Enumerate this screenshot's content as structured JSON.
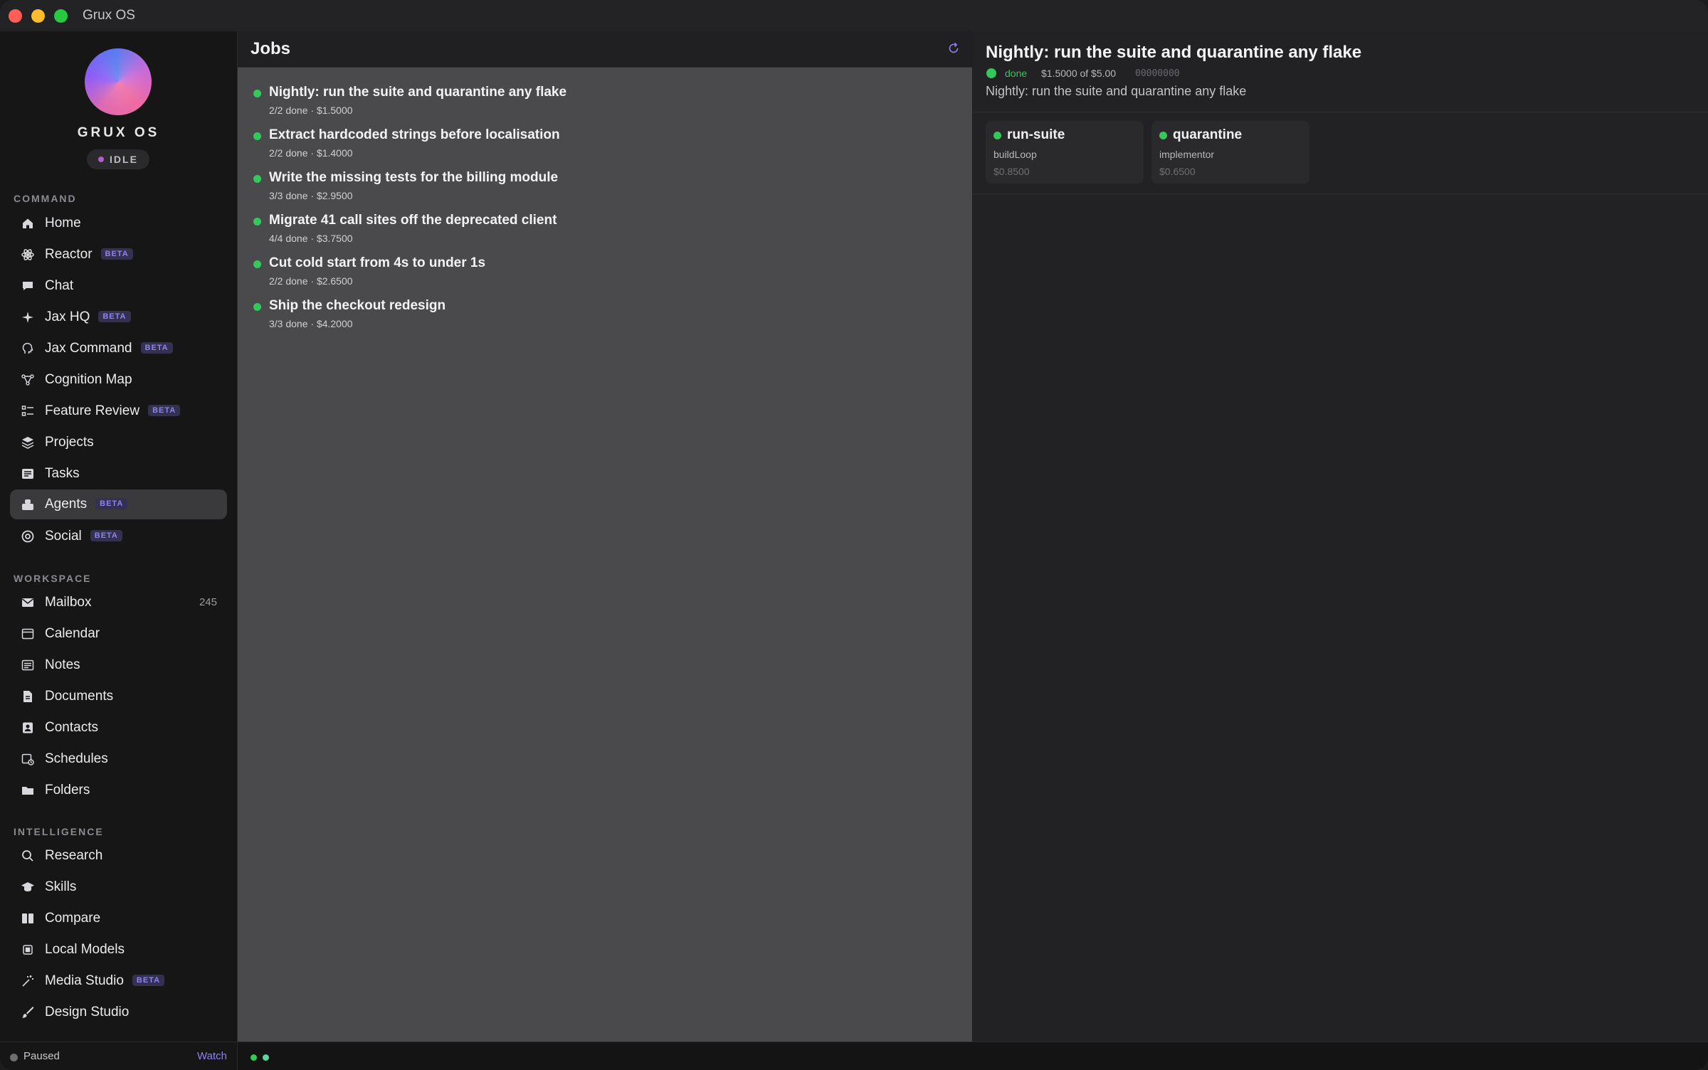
{
  "window": {
    "title": "Grux OS"
  },
  "sidebar": {
    "brand": "GRUX OS",
    "status": "IDLE",
    "sections": {
      "command": "COMMAND",
      "workspace": "WORKSPACE",
      "intelligence": "INTELLIGENCE"
    },
    "items": [
      {
        "label": "Home",
        "icon": "home-icon"
      },
      {
        "label": "Reactor",
        "icon": "atom-icon",
        "badge": "BETA"
      },
      {
        "label": "Chat",
        "icon": "chat-bubble-icon"
      },
      {
        "label": "Jax HQ",
        "icon": "sparkle-icon",
        "badge": "BETA"
      },
      {
        "label": "Jax Command",
        "icon": "head-icon",
        "badge": "BETA"
      },
      {
        "label": "Cognition Map",
        "icon": "graph-icon"
      },
      {
        "label": "Feature Review",
        "icon": "checklist-icon",
        "badge": "BETA"
      },
      {
        "label": "Projects",
        "icon": "layers-icon"
      },
      {
        "label": "Tasks",
        "icon": "tasks-icon"
      },
      {
        "label": "Agents",
        "icon": "agents-icon",
        "badge": "BETA"
      },
      {
        "label": "Social",
        "icon": "at-icon",
        "badge": "BETA"
      },
      {
        "label": "Mailbox",
        "icon": "envelope-icon",
        "count": "245"
      },
      {
        "label": "Calendar",
        "icon": "calendar-icon"
      },
      {
        "label": "Notes",
        "icon": "notes-icon"
      },
      {
        "label": "Documents",
        "icon": "document-icon"
      },
      {
        "label": "Contacts",
        "icon": "contacts-icon"
      },
      {
        "label": "Schedules",
        "icon": "schedule-icon"
      },
      {
        "label": "Folders",
        "icon": "folder-icon"
      },
      {
        "label": "Research",
        "icon": "search-icon"
      },
      {
        "label": "Skills",
        "icon": "graduation-cap-icon"
      },
      {
        "label": "Compare",
        "icon": "columns-icon"
      },
      {
        "label": "Local Models",
        "icon": "chip-icon"
      },
      {
        "label": "Media Studio",
        "icon": "magic-wand-icon",
        "badge": "BETA"
      },
      {
        "label": "Design Studio",
        "icon": "brush-icon"
      }
    ],
    "footer": {
      "status": "Paused",
      "action": "Watch"
    }
  },
  "jobs": {
    "title": "Jobs",
    "items": [
      {
        "title": "Nightly: run the suite and quarantine any flake",
        "meta": "2/2 done  · $1.5000"
      },
      {
        "title": "Extract hardcoded strings before localisation",
        "meta": "2/2 done  · $1.4000"
      },
      {
        "title": "Write the missing tests for the billing module",
        "meta": "3/3 done  · $2.9500"
      },
      {
        "title": "Migrate 41 call sites off the deprecated client",
        "meta": "4/4 done  · $3.7500"
      },
      {
        "title": "Cut cold start from 4s to under 1s",
        "meta": "2/2 done  · $2.6500"
      },
      {
        "title": "Ship the checkout redesign",
        "meta": "3/3 done  · $4.2000"
      }
    ]
  },
  "detail": {
    "title": "Nightly: run the suite and quarantine any flake",
    "status": "done",
    "budget": "$1.5000 of $5.00",
    "hash": "00000000",
    "description": "Nightly: run the suite and quarantine any flake",
    "cards": [
      {
        "name": "run-suite",
        "role": "buildLoop",
        "cost": "$0.8500"
      },
      {
        "name": "quarantine",
        "role": "implementor",
        "cost": "$0.6500"
      }
    ]
  },
  "colors": {
    "accent": "#8f83f0",
    "success": "#34c759",
    "statusIdle": "#b05fd0"
  }
}
